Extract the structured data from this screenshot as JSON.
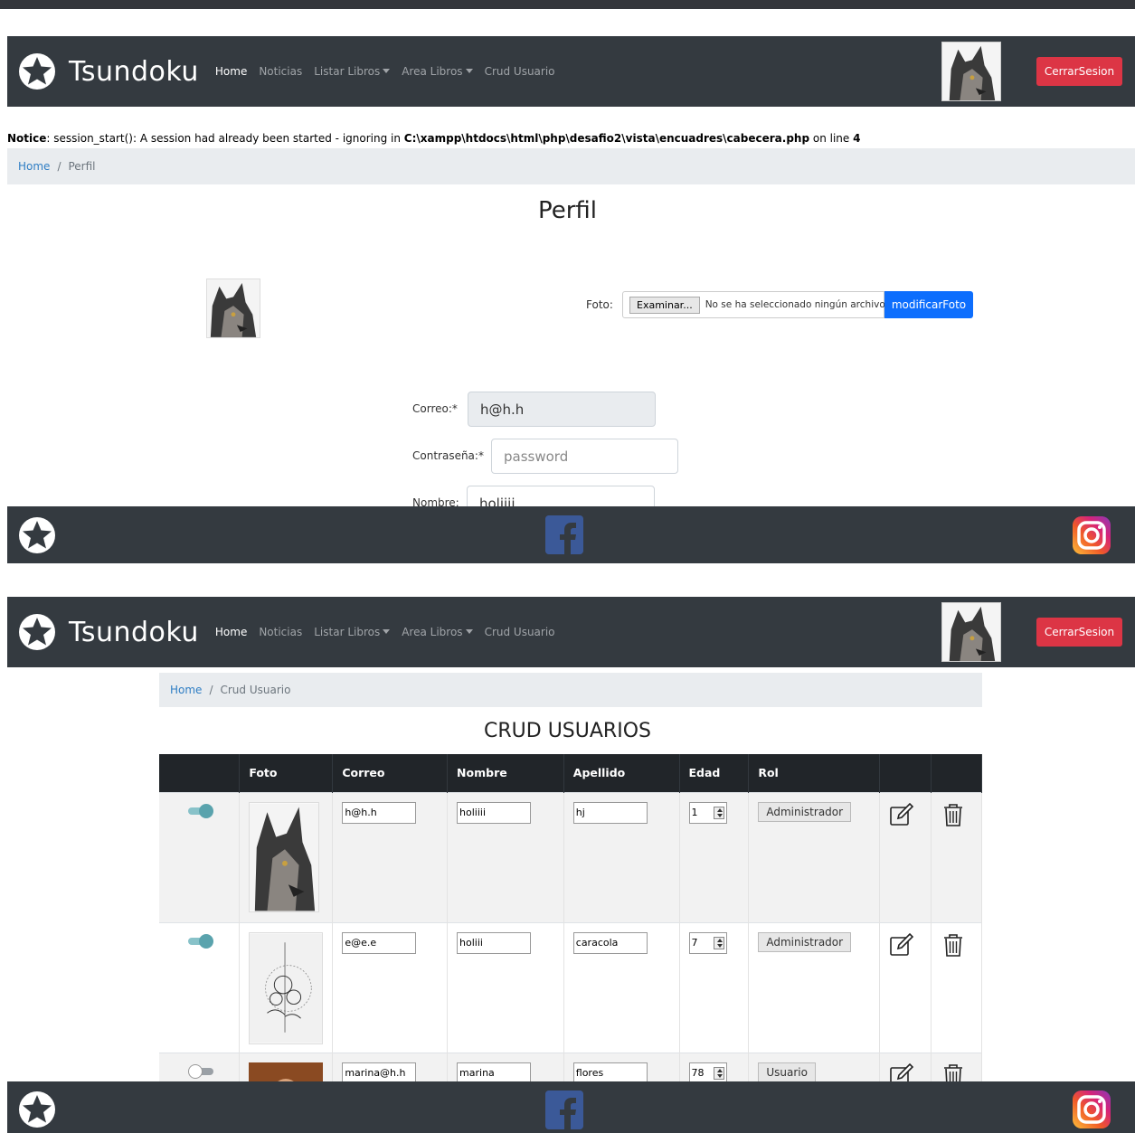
{
  "navbar": {
    "brand": "Tsundoku",
    "links": [
      {
        "label": "Home"
      },
      {
        "label": "Noticias"
      },
      {
        "label": "Listar Libros"
      },
      {
        "label": "Area Libros"
      },
      {
        "label": "Crud Usuario"
      }
    ],
    "logout_label": "CerrarSesion"
  },
  "profile_page": {
    "notice": {
      "prefix": "Notice",
      "message": ": session_start(): A session had already been started - ignoring in ",
      "path": "C:\\xampp\\htdocs\\html\\php\\desafio2\\vista\\encuadres\\cabecera.php",
      "line_text": " on line ",
      "line_number": "4"
    },
    "breadcrumb": {
      "home": "Home",
      "separator": "/",
      "current": "Perfil"
    },
    "title": "Perfil",
    "foto_label": "Foto:",
    "file_button": "Examinar...",
    "file_status": "No se ha seleccionado ningún archivo.",
    "modify_button": "modificarFoto",
    "fields": {
      "correo_label": "Correo:*",
      "correo_value": "h@h.h",
      "password_label": "Contraseña:*",
      "password_placeholder": "password",
      "nombre_label": "Nombre:",
      "nombre_value": "holiiii"
    }
  },
  "crud_page": {
    "breadcrumb": {
      "home": "Home",
      "separator": "/",
      "current": "Crud Usuario"
    },
    "title": "CRUD USUARIOS",
    "columns": [
      "",
      "Foto",
      "Correo",
      "Nombre",
      "Apellido",
      "Edad",
      "Rol",
      "",
      ""
    ],
    "rows": [
      {
        "active": true,
        "correo": "h@h.h",
        "nombre": "holiiii",
        "apellido": "hj",
        "edad": "1",
        "rol": "Administrador",
        "photo": "wolf-photo"
      },
      {
        "active": true,
        "correo": "e@e.e",
        "nombre": "holiii",
        "apellido": "caracola",
        "edad": "7",
        "rol": "Administrador",
        "photo": "flower-drawing"
      },
      {
        "active": false,
        "correo": "marina@h.h",
        "nombre": "marina",
        "apellido": "flores",
        "edad": "78",
        "rol": "Usuario",
        "photo": "portrait-photo"
      }
    ]
  },
  "icons": {
    "logo": "star-circle-icon",
    "edit": "edit-icon",
    "delete": "trash-icon",
    "facebook": "facebook-icon",
    "instagram": "instagram-icon"
  },
  "colors": {
    "navbar_bg": "#343a40",
    "logout_bg": "#dc3545",
    "primary": "#0d6efd",
    "link": "#2f7ec4",
    "toggle_on": "#5aa3ad",
    "facebook": "#3b5998"
  }
}
